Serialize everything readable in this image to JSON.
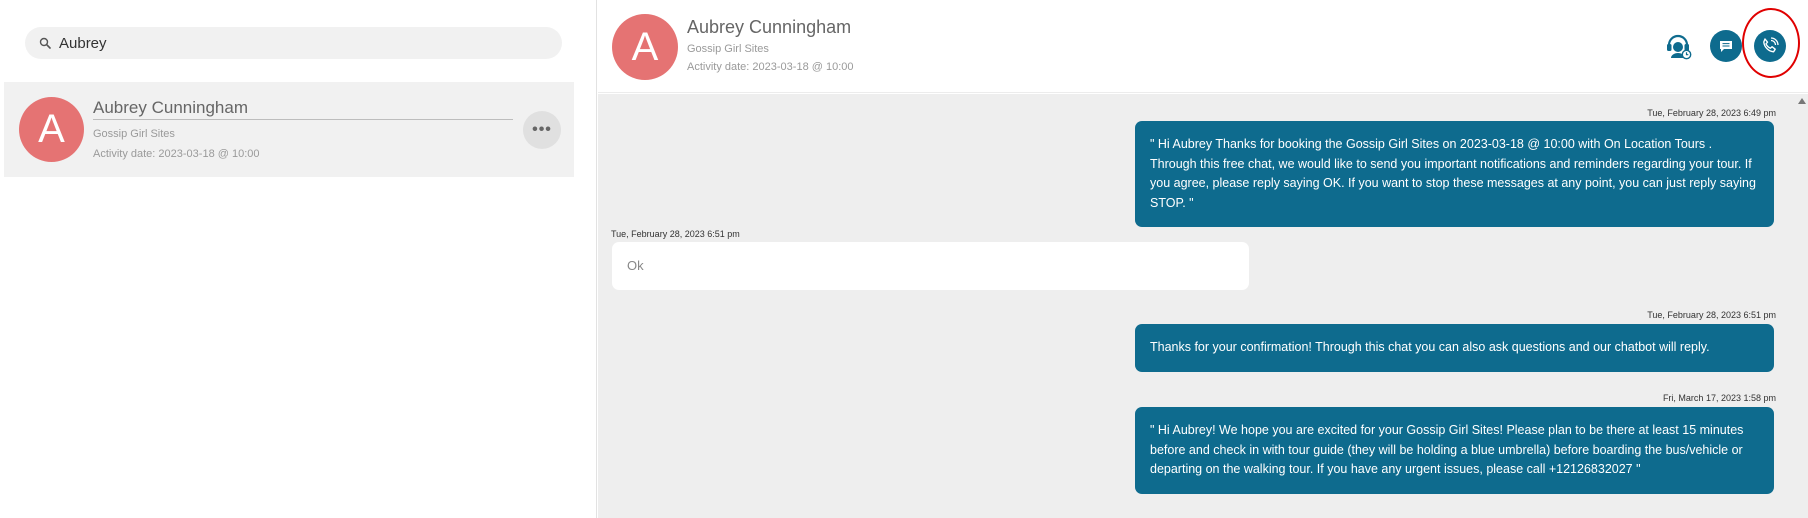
{
  "search": {
    "value": "Aubrey",
    "icon": "search-icon"
  },
  "contact_list": [
    {
      "avatar_letter": "A",
      "avatar_color": "#e57373",
      "name": "Aubrey Cunningham",
      "subtitle": "Gossip Girl Sites",
      "activity": "Activity date: 2023-03-18 @ 10:00",
      "more_label": "•••"
    }
  ],
  "header": {
    "avatar_letter": "A",
    "avatar_color": "#e57373",
    "name": "Aubrey Cunningham",
    "subtitle": "Gossip Girl Sites",
    "activity": "Activity date: 2023-03-18 @ 10:00",
    "actions": [
      {
        "name": "agent-icon",
        "color": "#0e6b8e"
      },
      {
        "name": "message-icon",
        "color": "#0e6b8e"
      },
      {
        "name": "phone-call-icon",
        "color": "#0e6b8e",
        "highlighted": true
      }
    ]
  },
  "colors": {
    "accent": "#0e6b8e",
    "avatar": "#e57373",
    "highlight_ring": "#e00000"
  },
  "messages": [
    {
      "direction": "out",
      "timestamp": "Tue, February 28, 2023 6:49 pm",
      "text": "\" Hi Aubrey Thanks for booking the Gossip Girl Sites on 2023-03-18 @ 10:00 with On Location Tours . Through this free chat, we would like to send you important notifications and reminders regarding your tour. If you agree, please reply saying OK. If you want to stop these messages at any point, you can just reply saying STOP. \""
    },
    {
      "direction": "in",
      "timestamp": "Tue, February 28, 2023 6:51 pm",
      "text": "Ok"
    },
    {
      "direction": "out",
      "timestamp": "Tue, February 28, 2023 6:51 pm",
      "text": "Thanks for your confirmation! Through this chat you can also ask questions and our chatbot will reply."
    },
    {
      "direction": "out",
      "timestamp": "Fri, March 17, 2023 1:58 pm",
      "text": "\" Hi Aubrey! We hope you are excited for your Gossip Girl Sites! Please plan to be there at least 15 minutes before and check in with tour guide (they will be holding a blue umbrella) before boarding the bus/vehicle or departing on the walking tour. If you have any urgent issues, please call +12126832027 \""
    }
  ]
}
